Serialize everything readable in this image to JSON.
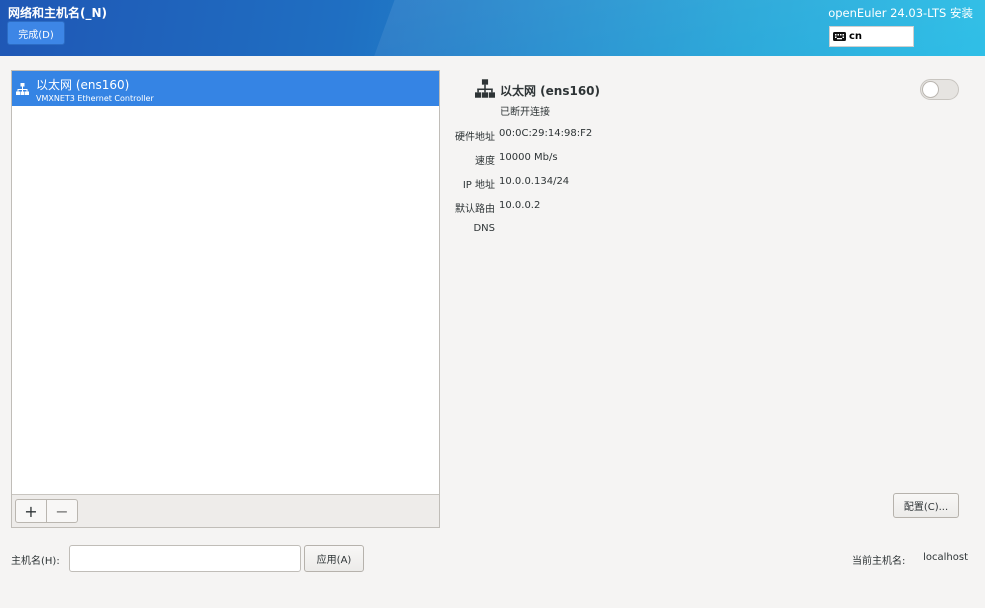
{
  "header": {
    "title": "网络和主机名(_N)",
    "done_label": "完成(D)",
    "product": "openEuler 24.03-LTS 安装",
    "keyboard_layout": "cn",
    "keyboard_icon": "keyboard-icon",
    "gradient_colors": [
      "#1f57b5",
      "#29bde6"
    ]
  },
  "devices": {
    "items": [
      {
        "name": "以太网 (ens160)",
        "description": "VMXNET3 Ethernet Controller",
        "icon": "wired-network-icon",
        "selected": true
      }
    ],
    "add_label": "+",
    "remove_label": "−"
  },
  "detail": {
    "icon": "wired-network-icon",
    "name": "以太网 (ens160)",
    "status": "已断开连接",
    "enabled": false,
    "properties": [
      {
        "label": "硬件地址",
        "value": "00:0C:29:14:98:F2"
      },
      {
        "label": "速度",
        "value": "10000 Mb/s"
      },
      {
        "label": "IP 地址",
        "value": "10.0.0.134/24"
      },
      {
        "label": "默认路由",
        "value": "10.0.0.2"
      },
      {
        "label": "DNS",
        "value": ""
      }
    ],
    "configure_label": "配置(C)..."
  },
  "hostname": {
    "label": "主机名(H):",
    "value": "",
    "placeholder": "",
    "apply_label": "应用(A)",
    "current_label": "当前主机名:",
    "current_value": "localhost"
  },
  "colors": {
    "selection": "#3584e4",
    "background": "#f5f4f3"
  }
}
